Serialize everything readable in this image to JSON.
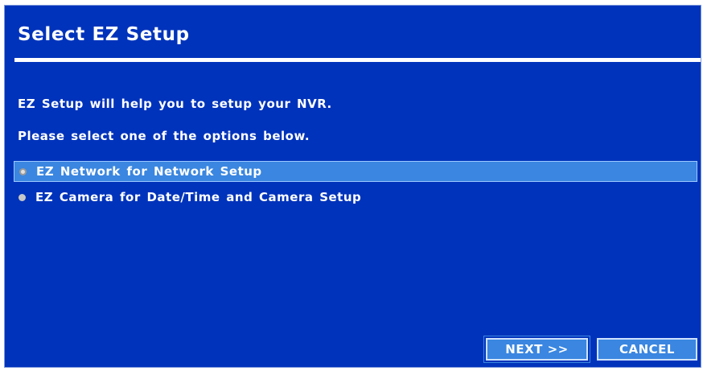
{
  "dialog": {
    "title": "Select EZ Setup",
    "message_line1": "EZ Setup will help you to setup your NVR.",
    "message_line2": "Please select one of the options below.",
    "options": [
      {
        "label": "EZ Network for Network Setup",
        "selected": true
      },
      {
        "label": "EZ Camera for Date/Time and Camera Setup",
        "selected": false
      }
    ],
    "buttons": {
      "next_label": "NEXT >>",
      "cancel_label": "CANCEL"
    }
  },
  "colors": {
    "background": "#0033bb",
    "highlight": "#3a86e0",
    "text": "#ffffff"
  }
}
